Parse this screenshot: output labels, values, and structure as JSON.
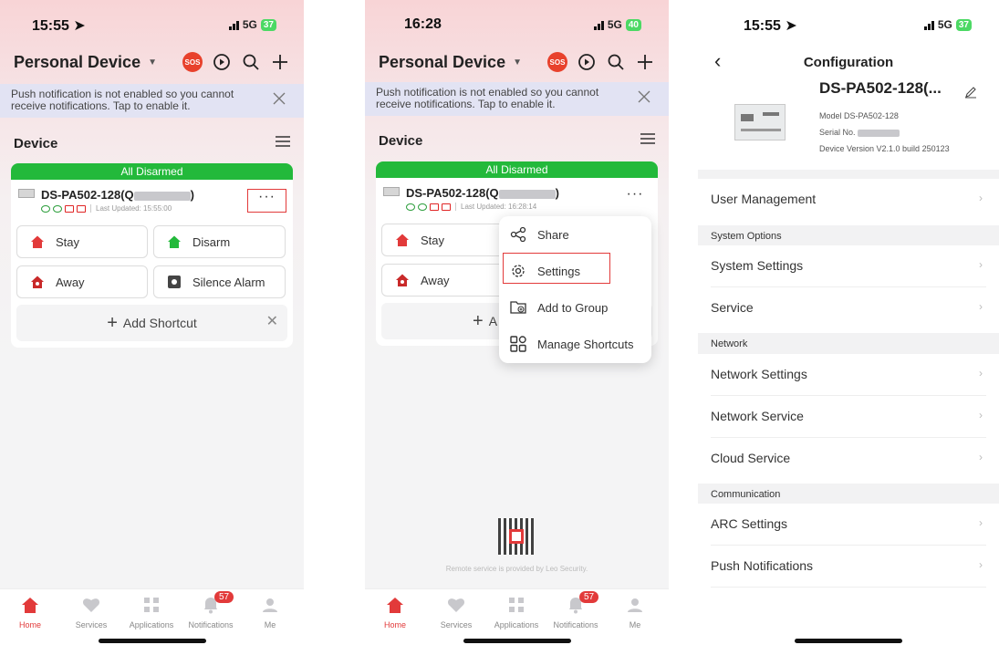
{
  "screen1": {
    "status": {
      "time": "15:55 ➤",
      "network": "5G",
      "battery": "37"
    },
    "app_title": "Personal Device",
    "sos": "SOS",
    "banner": "Push notification is not enabled so you cannot receive notifications. Tap to enable it.",
    "section": "Device",
    "card": {
      "status": "All Disarmed",
      "device_name": "DS-PA502-128(Q",
      "device_name_end": ")",
      "last_updated": "Last Updated: 15:55:00",
      "more": "···"
    },
    "buttons": {
      "stay": "Stay",
      "disarm": "Disarm",
      "away": "Away",
      "silence": "Silence Alarm",
      "add_shortcut": "Add Shortcut"
    }
  },
  "screen2": {
    "status": {
      "time": "16:28",
      "network": "5G",
      "battery": "40"
    },
    "app_title": "Personal Device",
    "sos": "SOS",
    "banner": "Push notification is not enabled so you cannot receive notifications. Tap to enable it.",
    "section": "Device",
    "card": {
      "status": "All Disarmed",
      "device_name": "DS-PA502-128(Q",
      "device_name_end": ")",
      "last_updated": "Last Updated: 16:28:14",
      "more": "···"
    },
    "buttons": {
      "stay": "Stay",
      "away": "Away",
      "add_shortcut_partial": "A"
    },
    "menu": {
      "share": "Share",
      "settings": "Settings",
      "add_group": "Add to Group",
      "manage": "Manage Shortcuts"
    },
    "remote_text": "Remote service is provided by Leo Security."
  },
  "tabs": [
    {
      "label": "Home"
    },
    {
      "label": "Services"
    },
    {
      "label": "Applications"
    },
    {
      "label": "Notifications",
      "badge": "57"
    },
    {
      "label": "Me"
    }
  ],
  "screen3": {
    "status": {
      "time": "15:55 ➤",
      "network": "5G",
      "battery": "37"
    },
    "back": "‹",
    "title": "Configuration",
    "device": {
      "name": "DS-PA502-128(...",
      "model": "Model DS-PA502-128",
      "serial": "Serial No.",
      "version": "Device Version V2.1.0 build 250123"
    },
    "rows": {
      "user_mgmt": "User Management",
      "sec_system": "System Options",
      "system_settings": "System Settings",
      "service": "Service",
      "sec_network": "Network",
      "network_settings": "Network Settings",
      "network_service": "Network Service",
      "cloud_service": "Cloud Service",
      "sec_comm": "Communication",
      "arc_settings": "ARC Settings",
      "push_notifications": "Push Notifications"
    }
  },
  "colors": {
    "accent": "#e23a3a",
    "armed_status": "#23b93b",
    "banner_bg": "#e2e3f3"
  }
}
